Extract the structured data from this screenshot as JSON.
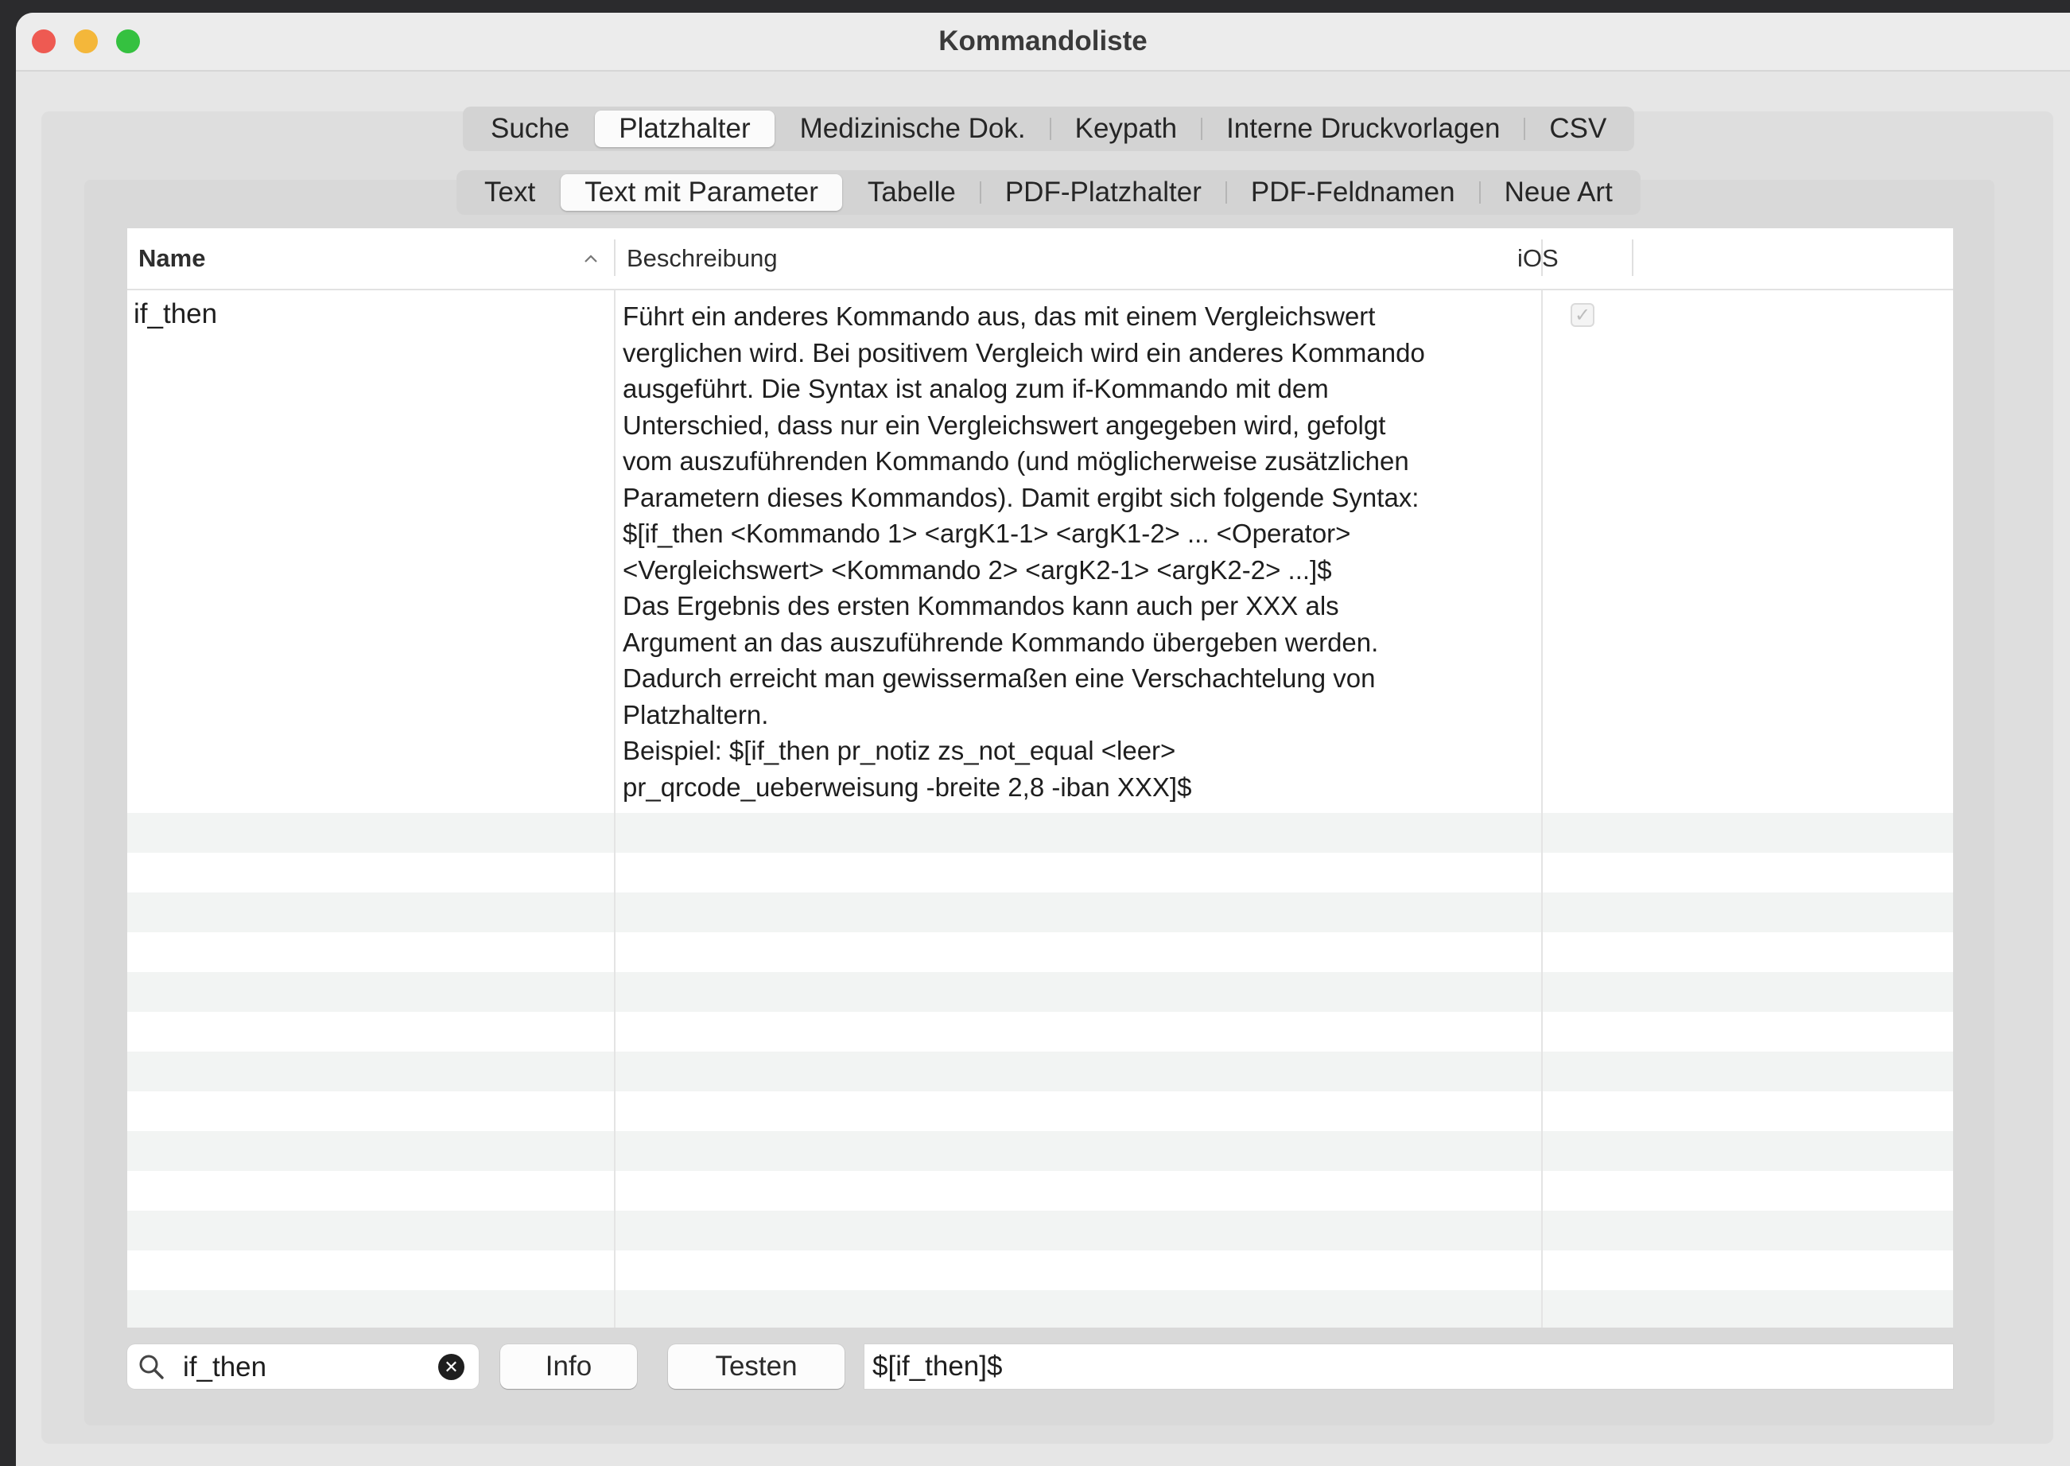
{
  "window": {
    "title": "Kommandoliste"
  },
  "tabs_top": [
    "Suche",
    "Platzhalter",
    "Medizinische Dok.",
    "Keypath",
    "Interne Druckvorlagen",
    "CSV"
  ],
  "tabs_top_selected": "Platzhalter",
  "tabs_sub": [
    "Text",
    "Text mit Parameter",
    "Tabelle",
    "PDF-Platzhalter",
    "PDF-Feldnamen",
    "Neue Art"
  ],
  "tabs_sub_selected": "Text mit Parameter",
  "table": {
    "columns": {
      "name": "Name",
      "description": "Beschreibung",
      "ios": "iOS"
    },
    "sort_indicator": "^",
    "rows": [
      {
        "name": "if_then",
        "description_lines": [
          "Führt ein anderes Kommando aus, das mit einem Vergleichswert",
          "verglichen wird. Bei positivem Vergleich wird ein anderes Kommando",
          "ausgeführt. Die Syntax ist analog zum if-Kommando mit dem",
          "Unterschied, dass nur ein Vergleichswert angegeben wird, gefolgt",
          "vom auszuführenden Kommando (und möglicherweise zusätzlichen",
          "Parametern dieses Kommandos). Damit ergibt sich folgende Syntax:",
          "$[if_then <Kommando 1> <argK1-1> <argK1-2> ... <Operator>",
          "<Vergleichswert> <Kommando 2> <argK2-1> <argK2-2> ...]$",
          "Das Ergebnis des ersten Kommandos kann auch per XXX als",
          "Argument an das auszuführende Kommando übergeben werden.",
          "Dadurch erreicht man gewissermaßen eine Verschachtelung von",
          "Platzhaltern.",
          "Beispiel: $[if_then pr_notiz zs_not_equal <leer>",
          "pr_qrcode_ueberweisung -breite 2,8 -iban XXX]$"
        ],
        "ios_checked": true
      }
    ]
  },
  "search": {
    "value": "if_then",
    "icon": "magnifier",
    "clear_icon": "x-circle"
  },
  "buttons": {
    "info": "Info",
    "test": "Testen"
  },
  "result": {
    "value": "$[if_then]$"
  },
  "colors": {
    "close": "#ee5a52",
    "minimize": "#f4b73a",
    "maximize": "#35c140"
  }
}
